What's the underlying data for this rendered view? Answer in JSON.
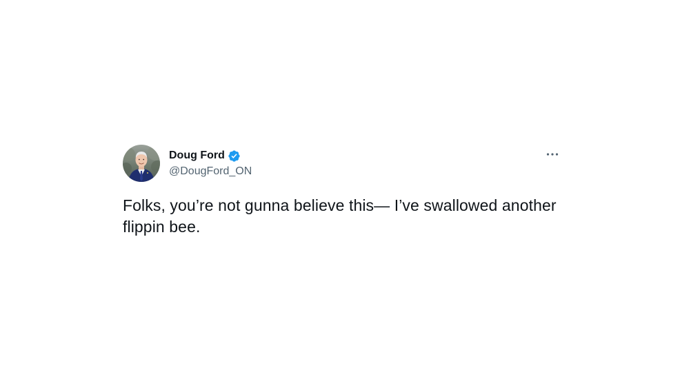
{
  "tweet": {
    "author": {
      "display_name": "Doug Ford",
      "handle": "@DougFord_ON",
      "verified": true
    },
    "text": "Folks, you’re not gunna believe this— I’ve swallowed another flippin bee.",
    "icons": {
      "verified": "verified-badge-icon",
      "more": "more-options-icon"
    }
  },
  "colors": {
    "text_primary": "#0f1419",
    "text_secondary": "#536471",
    "verified_blue": "#1d9bf0",
    "background": "#ffffff"
  }
}
